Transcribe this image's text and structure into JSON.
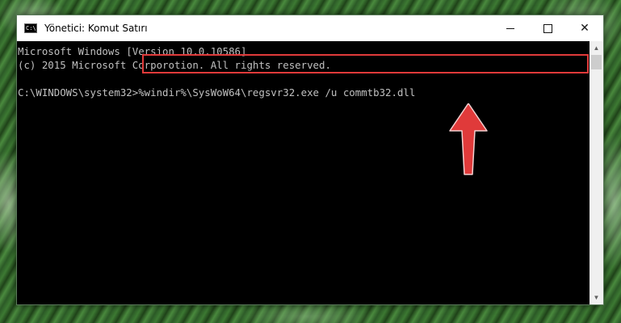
{
  "window": {
    "title": "Yönetici: Komut Satırı",
    "icon_label": "C:\\"
  },
  "controls": {
    "minimize_icon": "minimize-icon",
    "maximize_icon": "maximize-icon",
    "close_glyph": "✕"
  },
  "console": {
    "lines": [
      "Microsoft Windows [Version 10.0.10586]",
      "(c) 2015 Microsoft Corporotion. All rights reserved.",
      "",
      "C:\\WINDOWS\\system32>%windir%\\SysWoW64\\regsvr32.exe /u commtb32.dll"
    ],
    "highlight_color": "#e03a3a"
  },
  "scrollbar": {
    "up_glyph": "▲",
    "down_glyph": "▼"
  },
  "annotation": {
    "arrow_color": "#e03a3a",
    "arrow_icon": "up-arrow-icon"
  }
}
